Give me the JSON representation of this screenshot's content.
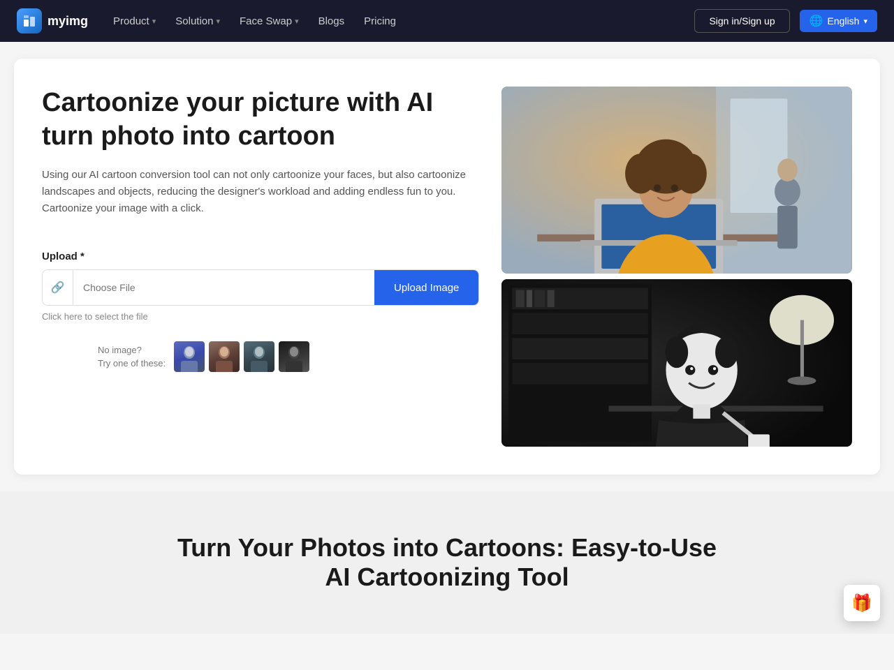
{
  "navbar": {
    "logo_text": "myimg",
    "logo_icon": "M",
    "nav_items": [
      {
        "label": "Product",
        "has_chevron": true
      },
      {
        "label": "Solution",
        "has_chevron": true
      },
      {
        "label": "Face Swap",
        "has_chevron": true
      },
      {
        "label": "Blogs",
        "has_chevron": false
      },
      {
        "label": "Pricing",
        "has_chevron": false
      }
    ],
    "signin_label": "Sign in/Sign up",
    "lang_label": "English"
  },
  "hero": {
    "title": "Cartoonize your picture with AI turn photo into cartoon",
    "description": "Using our AI cartoon conversion tool can not only cartoonize your faces, but also cartoonize landscapes and objects, reducing the designer's workload and adding endless fun to you. Cartoonize your image with a click.",
    "upload_label": "Upload *",
    "file_placeholder": "Choose File",
    "upload_button": "Upload Image",
    "upload_hint": "Click here to select the file",
    "sample_label_line1": "No image?",
    "sample_label_line2": "Try one of these:"
  },
  "below": {
    "title": "Turn Your Photos into Cartoons: Easy-to-Use AI Cartoonizing Tool"
  },
  "floating": {
    "icon": "🎁"
  },
  "icons": {
    "link": "🔗",
    "globe": "🌐",
    "chevron_down": "▾"
  }
}
